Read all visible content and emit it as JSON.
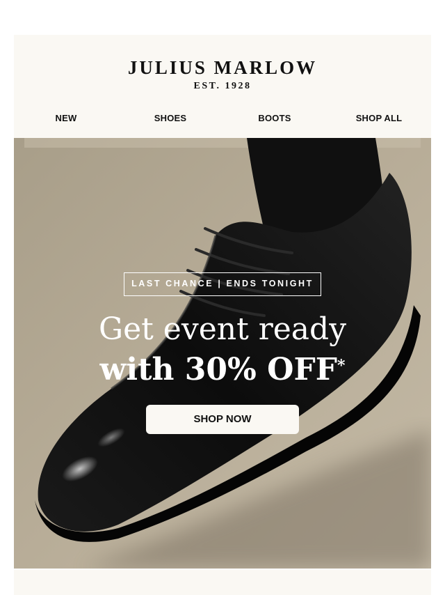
{
  "brand": {
    "name": "JULIUS MARLOW",
    "tagline": "EST. 1928"
  },
  "nav": {
    "items": [
      {
        "label": "NEW"
      },
      {
        "label": "SHOES"
      },
      {
        "label": "BOOTS"
      },
      {
        "label": "SHOP ALL"
      }
    ]
  },
  "hero": {
    "badge": "LAST CHANCE | ENDS TONIGHT",
    "headline_line1": "Get event ready",
    "headline_line2": "with 30% OFF",
    "headline_mark": "*",
    "cta_label": "SHOP NOW"
  },
  "colors": {
    "header_bg": "#faf8f3",
    "hero_bg": "#b5aa95",
    "text_dark": "#111111",
    "text_light": "#ffffff"
  }
}
